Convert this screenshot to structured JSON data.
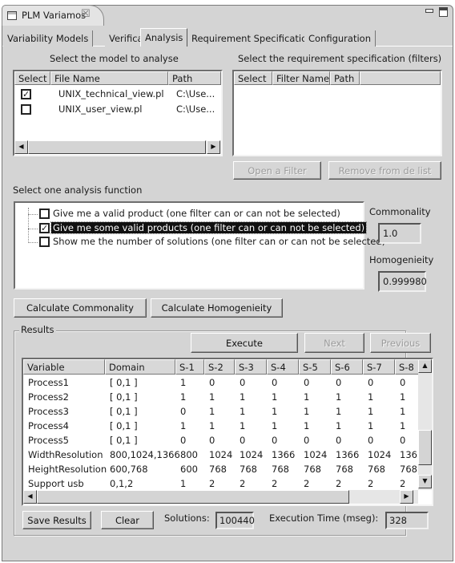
{
  "window": {
    "view_title": "PLM Variamos",
    "view_icon": "view-window-icon",
    "close_icon": "close-icon",
    "minimize_icon": "minimize-icon",
    "maximize_icon": "maximize-icon"
  },
  "tabs": [
    {
      "label": "Variability Models",
      "active": false
    },
    {
      "label": "Verification",
      "active": false
    },
    {
      "label": "Analysis",
      "active": true
    },
    {
      "label": "Requirement Specification",
      "active": false
    },
    {
      "label": "Configuration",
      "active": false
    }
  ],
  "models": {
    "title": "Select the model to analyse",
    "columns": [
      "Select",
      "File Name",
      "Path"
    ],
    "rows": [
      {
        "checked": true,
        "file": "UNIX_technical_view.pl",
        "path": "C:\\Use..."
      },
      {
        "checked": false,
        "file": "UNIX_user_view.pl",
        "path": "C:\\Use..."
      }
    ]
  },
  "filters": {
    "title": "Select the requirement specification (filters)",
    "columns": [
      "Select",
      "Filter Name",
      "Path"
    ],
    "rows": [],
    "open_button": "Open a Filter",
    "remove_button": "Remove from de list"
  },
  "analysis": {
    "title": "Select one analysis function",
    "functions": [
      {
        "label": "Give me a valid product (one filter can or can not be selected)",
        "checked": false,
        "selected": false
      },
      {
        "label": "Give me some valid products (one filter can or can not be selected)",
        "checked": true,
        "selected": true
      },
      {
        "label": "Show me the number of solutions (one filter can or can not be selected)",
        "checked": false,
        "selected": false
      }
    ],
    "commonality_label": "Commonality",
    "commonality_value": "1.0",
    "homogeneity_label": "Homogenieity",
    "homogeneity_value": "0.999980",
    "calc_commonality_button": "Calculate Commonality",
    "calc_homogeneity_button": "Calculate Homogenieity"
  },
  "results": {
    "title": "Results",
    "execute_button": "Execute",
    "next_button": "Next",
    "previous_button": "Previous",
    "columns": [
      "Variable",
      "Domain",
      "S-1",
      "S-2",
      "S-3",
      "S-4",
      "S-5",
      "S-6",
      "S-7",
      "S-8"
    ],
    "rows": [
      [
        "Process1",
        "[ 0,1 ]",
        "1",
        "0",
        "0",
        "0",
        "0",
        "0",
        "0",
        "0"
      ],
      [
        "Process2",
        "[ 0,1 ]",
        "1",
        "1",
        "1",
        "1",
        "1",
        "1",
        "1",
        "1"
      ],
      [
        "Process3",
        "[ 0,1 ]",
        "0",
        "1",
        "1",
        "1",
        "1",
        "1",
        "1",
        "1"
      ],
      [
        "Process4",
        "[ 0,1 ]",
        "1",
        "1",
        "1",
        "1",
        "1",
        "1",
        "1",
        "1"
      ],
      [
        "Process5",
        "[ 0,1 ]",
        "0",
        "0",
        "0",
        "0",
        "0",
        "0",
        "0",
        "0"
      ],
      [
        "WidthResolution",
        "800,1024,1366",
        "800",
        "1024",
        "1024",
        "1366",
        "1024",
        "1366",
        "1024",
        "136"
      ],
      [
        "HeightResolution",
        "600,768",
        "600",
        "768",
        "768",
        "768",
        "768",
        "768",
        "768",
        "768"
      ],
      [
        "Support  usb",
        "0,1,2",
        "1",
        "2",
        "2",
        "2",
        "2",
        "2",
        "2",
        "2"
      ]
    ],
    "save_button": "Save Results",
    "clear_button": "Clear",
    "solutions_label": "Solutions:",
    "solutions_value": "100440",
    "exec_time_label": "Execution Time (mseg):",
    "exec_time_value": "328"
  }
}
